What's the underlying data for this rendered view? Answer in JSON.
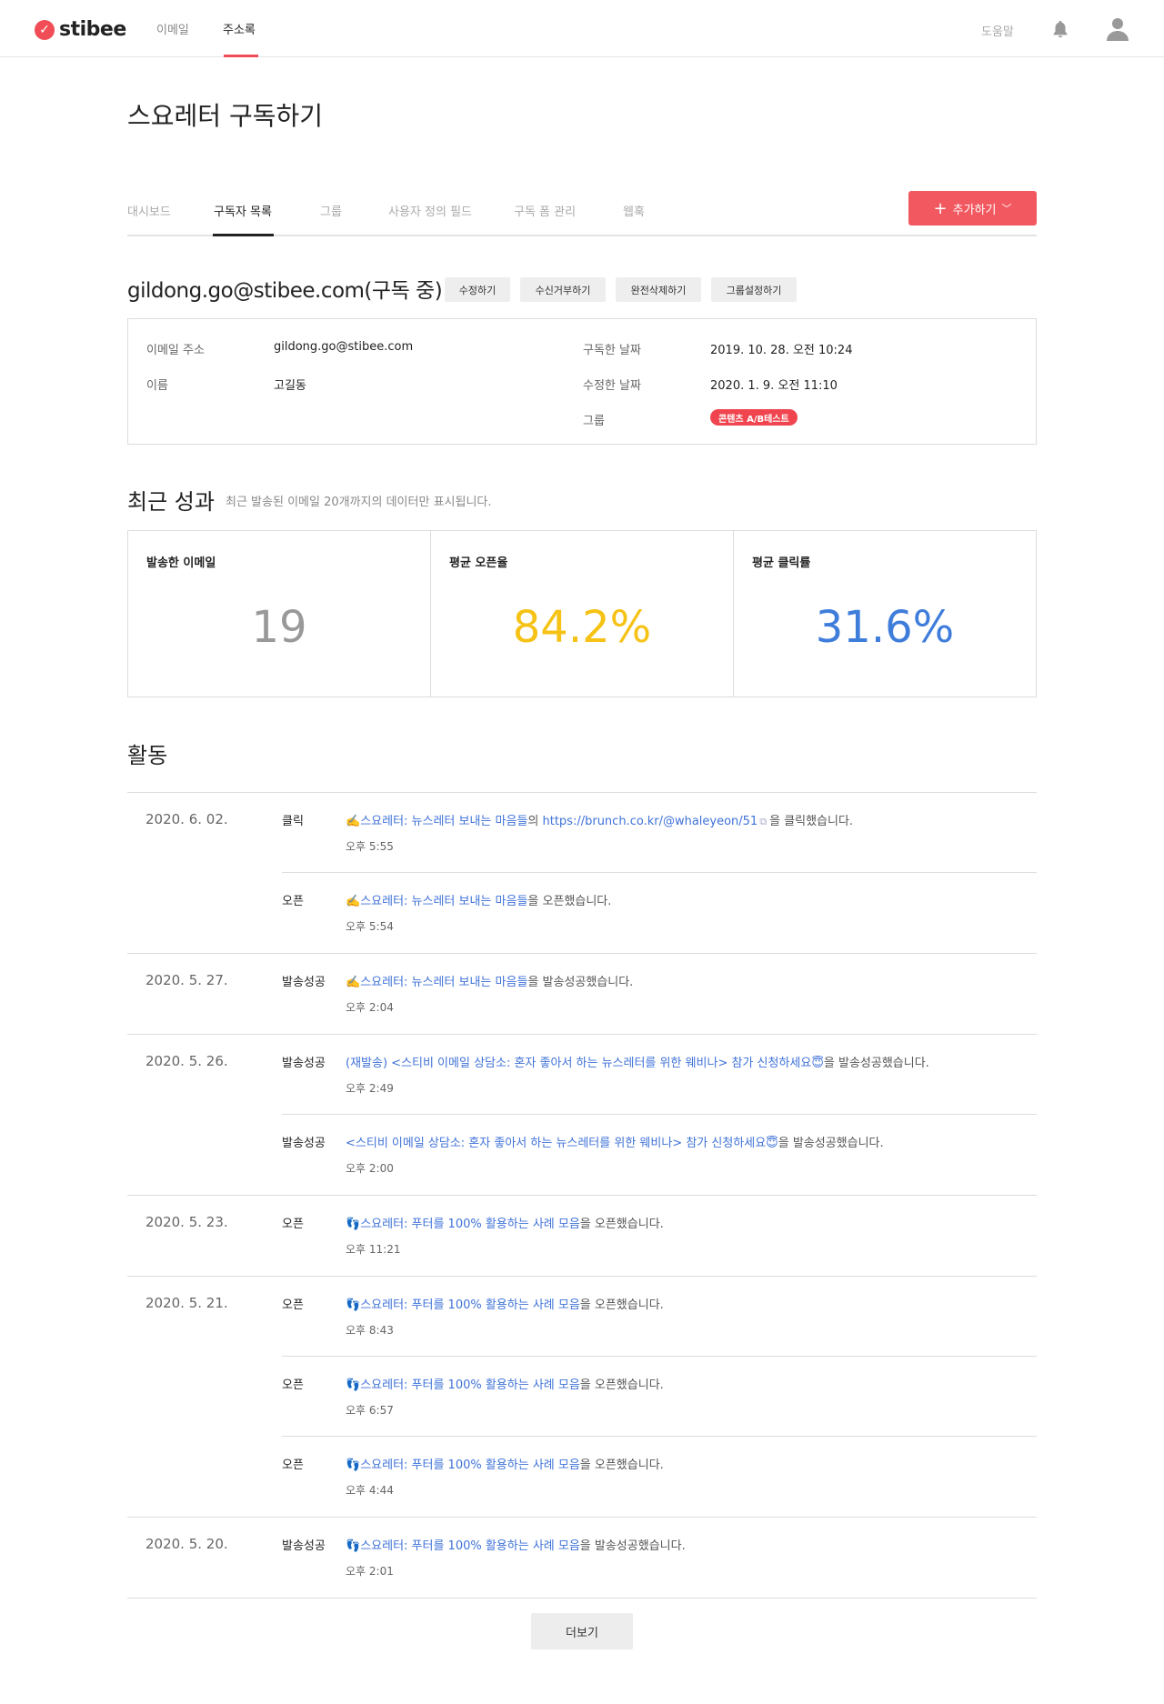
{
  "brand": {
    "name": "stibee",
    "accent": "#f04d57"
  },
  "nav": {
    "items": [
      {
        "label": "이메일"
      },
      {
        "label": "주소록"
      }
    ],
    "help": "도움말"
  },
  "page": {
    "title": "스요레터 구독하기"
  },
  "tabs": [
    {
      "label": "대시보드"
    },
    {
      "label": "구독자 목록"
    },
    {
      "label": "그룹"
    },
    {
      "label": "사용자 정의 필드"
    },
    {
      "label": "구독 폼 관리"
    },
    {
      "label": "웹훅"
    }
  ],
  "add_button": {
    "label": "추가하기"
  },
  "subscriber": {
    "heading": "gildong.go@stibee.com(구독 중)",
    "actions": [
      "수정하기",
      "수신거부하기",
      "완전삭제하기",
      "그룹설정하기"
    ],
    "fields": {
      "email_label": "이메일 주소",
      "email_value": "gildong.go@stibee.com",
      "name_label": "이름",
      "name_value": "고길동",
      "subscribed_label": "구독한 날짜",
      "subscribed_value": "2019. 10. 28. 오전 10:24",
      "modified_label": "수정한 날짜",
      "modified_value": "2020. 1. 9. 오전 11:10",
      "group_label": "그룹",
      "group_value": "콘텐츠 A/B테스트"
    }
  },
  "performance": {
    "title": "최근 성과",
    "note": "최근 발송된 이메일 20개까지의 데이터만 표시됩니다.",
    "cards": [
      {
        "label": "발송한 이메일",
        "value": "19",
        "color": "#999999"
      },
      {
        "label": "평균 오픈율",
        "value": "84.2%",
        "color": "#f5c215"
      },
      {
        "label": "평균 클릭률",
        "value": "31.6%",
        "color": "#3f7ddb"
      }
    ]
  },
  "activity": {
    "title": "활동",
    "groups": [
      {
        "date": "2020. 6. 02.",
        "events": [
          {
            "type": "클릭",
            "emoji": "✍️",
            "link": "스요레터: 뉴스레터 보내는 마음들",
            "mid": "의 ",
            "url": "https://brunch.co.kr/@whaleyeon/51",
            "suffix": "을 클릭했습니다.",
            "time": "오후 5:55"
          },
          {
            "type": "오픈",
            "emoji": "✍️",
            "link": "스요레터: 뉴스레터 보내는 마음들",
            "mid": "",
            "url": "",
            "suffix": "을 오픈했습니다.",
            "time": "오후 5:54"
          }
        ]
      },
      {
        "date": "2020. 5. 27.",
        "events": [
          {
            "type": "발송성공",
            "emoji": "✍️",
            "link": "스요레터: 뉴스레터 보내는 마음들",
            "mid": "",
            "url": "",
            "suffix": "을 발송성공했습니다.",
            "time": "오후 2:04"
          }
        ]
      },
      {
        "date": "2020. 5. 26.",
        "events": [
          {
            "type": "발송성공",
            "emoji": "",
            "link": "(재발송) <스티비 이메일 상담소: 혼자 좋아서 하는 뉴스레터를 위한 웨비나> 참가 신청하세요😇",
            "mid": "",
            "url": "",
            "suffix": "을 발송성공했습니다.",
            "time": "오후 2:49"
          },
          {
            "type": "발송성공",
            "emoji": "",
            "link": "<스티비 이메일 상담소: 혼자 좋아서 하는 뉴스레터를 위한 웨비나> 참가 신청하세요😇",
            "mid": "",
            "url": "",
            "suffix": "을 발송성공했습니다.",
            "time": "오후 2:00"
          }
        ]
      },
      {
        "date": "2020. 5. 23.",
        "events": [
          {
            "type": "오픈",
            "emoji": "👣",
            "link": "스요레터: 푸터를 100% 활용하는 사례 모음",
            "mid": "",
            "url": "",
            "suffix": "을 오픈했습니다.",
            "time": "오후 11:21"
          }
        ]
      },
      {
        "date": "2020. 5. 21.",
        "events": [
          {
            "type": "오픈",
            "emoji": "👣",
            "link": "스요레터: 푸터를 100% 활용하는 사례 모음",
            "mid": "",
            "url": "",
            "suffix": "을 오픈했습니다.",
            "time": "오후 8:43"
          },
          {
            "type": "오픈",
            "emoji": "👣",
            "link": "스요레터: 푸터를 100% 활용하는 사례 모음",
            "mid": "",
            "url": "",
            "suffix": "을 오픈했습니다.",
            "time": "오후 6:57"
          },
          {
            "type": "오픈",
            "emoji": "👣",
            "link": "스요레터: 푸터를 100% 활용하는 사례 모음",
            "mid": "",
            "url": "",
            "suffix": "을 오픈했습니다.",
            "time": "오후 4:44"
          }
        ]
      },
      {
        "date": "2020. 5. 20.",
        "events": [
          {
            "type": "발송성공",
            "emoji": "👣",
            "link": "스요레터: 푸터를 100% 활용하는 사례 모음",
            "mid": "",
            "url": "",
            "suffix": "을 발송성공했습니다.",
            "time": "오후 2:01"
          }
        ]
      }
    ]
  },
  "more_button": {
    "label": "더보기"
  }
}
